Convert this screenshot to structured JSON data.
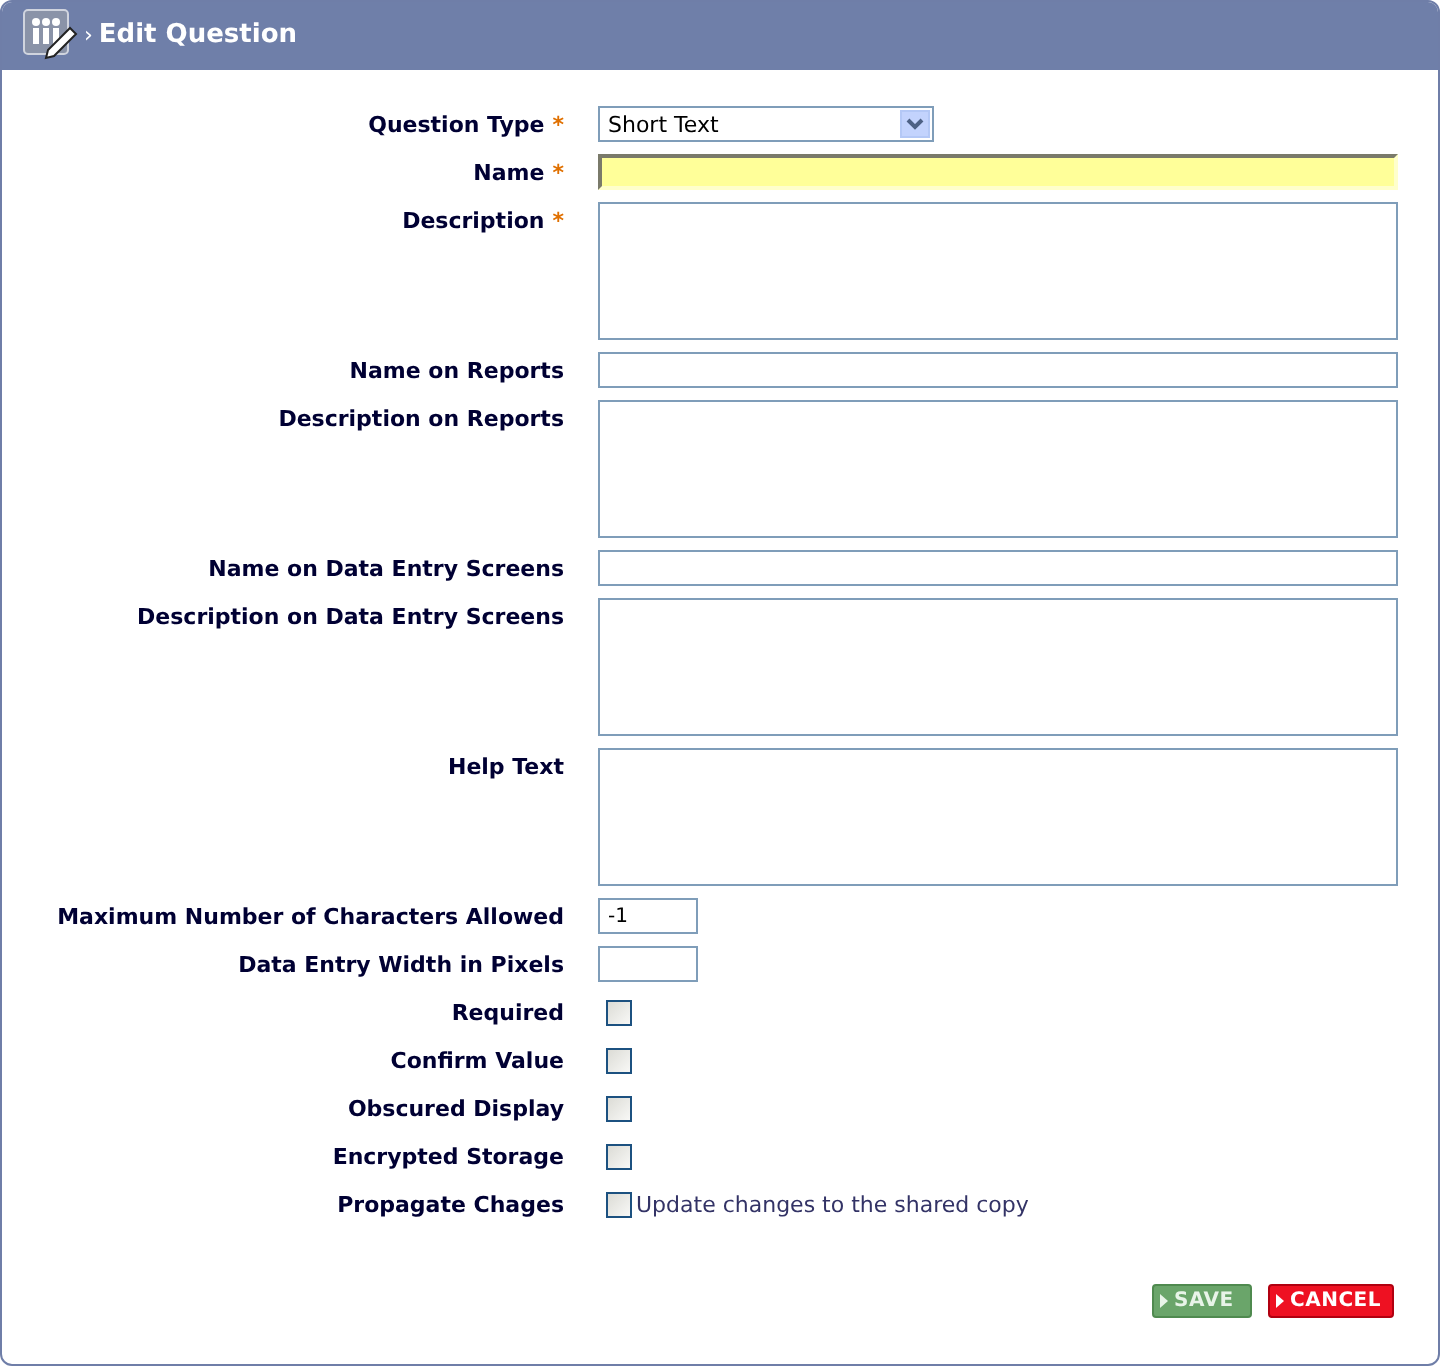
{
  "window": {
    "title": "Edit Question",
    "breadcrumb_separator": "›"
  },
  "fields": [
    {
      "kind": "select",
      "label": "Question Type",
      "required_mark": "*",
      "value": "Short Text"
    },
    {
      "kind": "input",
      "label": "Name",
      "required_mark": "*",
      "focused": true
    },
    {
      "kind": "textarea",
      "label": "Description",
      "required_mark": "*"
    },
    {
      "kind": "input",
      "label": "Name on Reports",
      "focused": false
    },
    {
      "kind": "textarea",
      "label": "Description on Reports"
    },
    {
      "kind": "input",
      "label": "Name on Data Entry Screens",
      "focused": false
    },
    {
      "kind": "textarea",
      "label": "Description on Data Entry Screens"
    },
    {
      "kind": "textarea",
      "label": "Help Text"
    },
    {
      "kind": "small",
      "label": "Maximum Number of Characters Allowed",
      "value": "-1"
    },
    {
      "kind": "small",
      "label": "Data Entry Width in Pixels"
    },
    {
      "kind": "checkbox",
      "label": "Required",
      "checked": false
    },
    {
      "kind": "checkbox",
      "label": "Confirm Value",
      "checked": false
    },
    {
      "kind": "checkbox",
      "label": "Obscured Display",
      "checked": false
    },
    {
      "kind": "checkbox",
      "label": "Encrypted Storage",
      "checked": false
    },
    {
      "kind": "checkbox",
      "label": "Propagate Chages",
      "checked": false,
      "caption": "Update changes to the shared copy"
    }
  ],
  "buttons": [
    {
      "kind": "save",
      "label": "SAVE"
    },
    {
      "kind": "cancel",
      "label": "CANCEL"
    }
  ]
}
